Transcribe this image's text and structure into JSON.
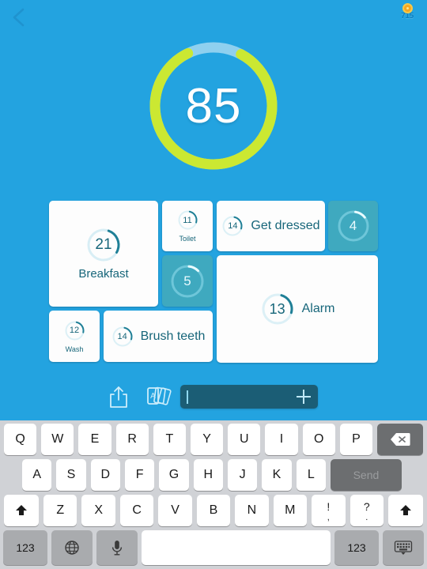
{
  "app": {
    "background_color": "#23a3e0",
    "accent_teal": "#3fa9bf",
    "progress_green": "#cbe832"
  },
  "topbar": {
    "back_icon": "chevron-left-icon",
    "coin_icon": "coin-icon",
    "coin_count": "715"
  },
  "hero": {
    "progress_value": "85",
    "progress_percent": 85,
    "ring_color": "#cbe832",
    "track_color": "#8fd0ef"
  },
  "tasks": [
    {
      "id": "breakfast",
      "number": "21",
      "label": "Breakfast",
      "selected": false,
      "layout": "stack"
    },
    {
      "id": "toilet",
      "number": "11",
      "label": "Toilet",
      "selected": false,
      "layout": "stack"
    },
    {
      "id": "get-dressed",
      "number": "14",
      "label": "Get dressed",
      "selected": false,
      "layout": "side"
    },
    {
      "id": "task-4",
      "number": "4",
      "label": "",
      "selected": true,
      "layout": "none"
    },
    {
      "id": "task-5",
      "number": "5",
      "label": "",
      "selected": true,
      "layout": "none"
    },
    {
      "id": "alarm",
      "number": "13",
      "label": "Alarm",
      "selected": false,
      "layout": "side"
    },
    {
      "id": "wash",
      "number": "12",
      "label": "Wash",
      "selected": false,
      "layout": "stack"
    },
    {
      "id": "brush-teeth",
      "number": "14",
      "label": "Brush teeth",
      "selected": false,
      "layout": "side"
    }
  ],
  "toolbar": {
    "share_icon": "share-icon",
    "cards_icon": "cards-icon",
    "input_value": "",
    "add_icon": "plus-icon"
  },
  "keyboard": {
    "row1": [
      "Q",
      "W",
      "E",
      "R",
      "T",
      "Y",
      "U",
      "I",
      "O",
      "P"
    ],
    "backspace_icon": "backspace-icon",
    "row2": [
      "A",
      "S",
      "D",
      "F",
      "G",
      "H",
      "J",
      "K",
      "L"
    ],
    "send_label": "Send",
    "row3": [
      "Z",
      "X",
      "C",
      "V",
      "B",
      "N",
      "M"
    ],
    "shift_icon": "shift-up-icon",
    "punct1_top": "!",
    "punct1_bottom": ",",
    "punct2_top": "?",
    "punct2_bottom": ".",
    "num_label": "123",
    "globe_icon": "globe-icon",
    "mic_icon": "microphone-icon",
    "space_label": "",
    "num_label_right": "123",
    "dismiss_icon": "keyboard-dismiss-icon"
  }
}
